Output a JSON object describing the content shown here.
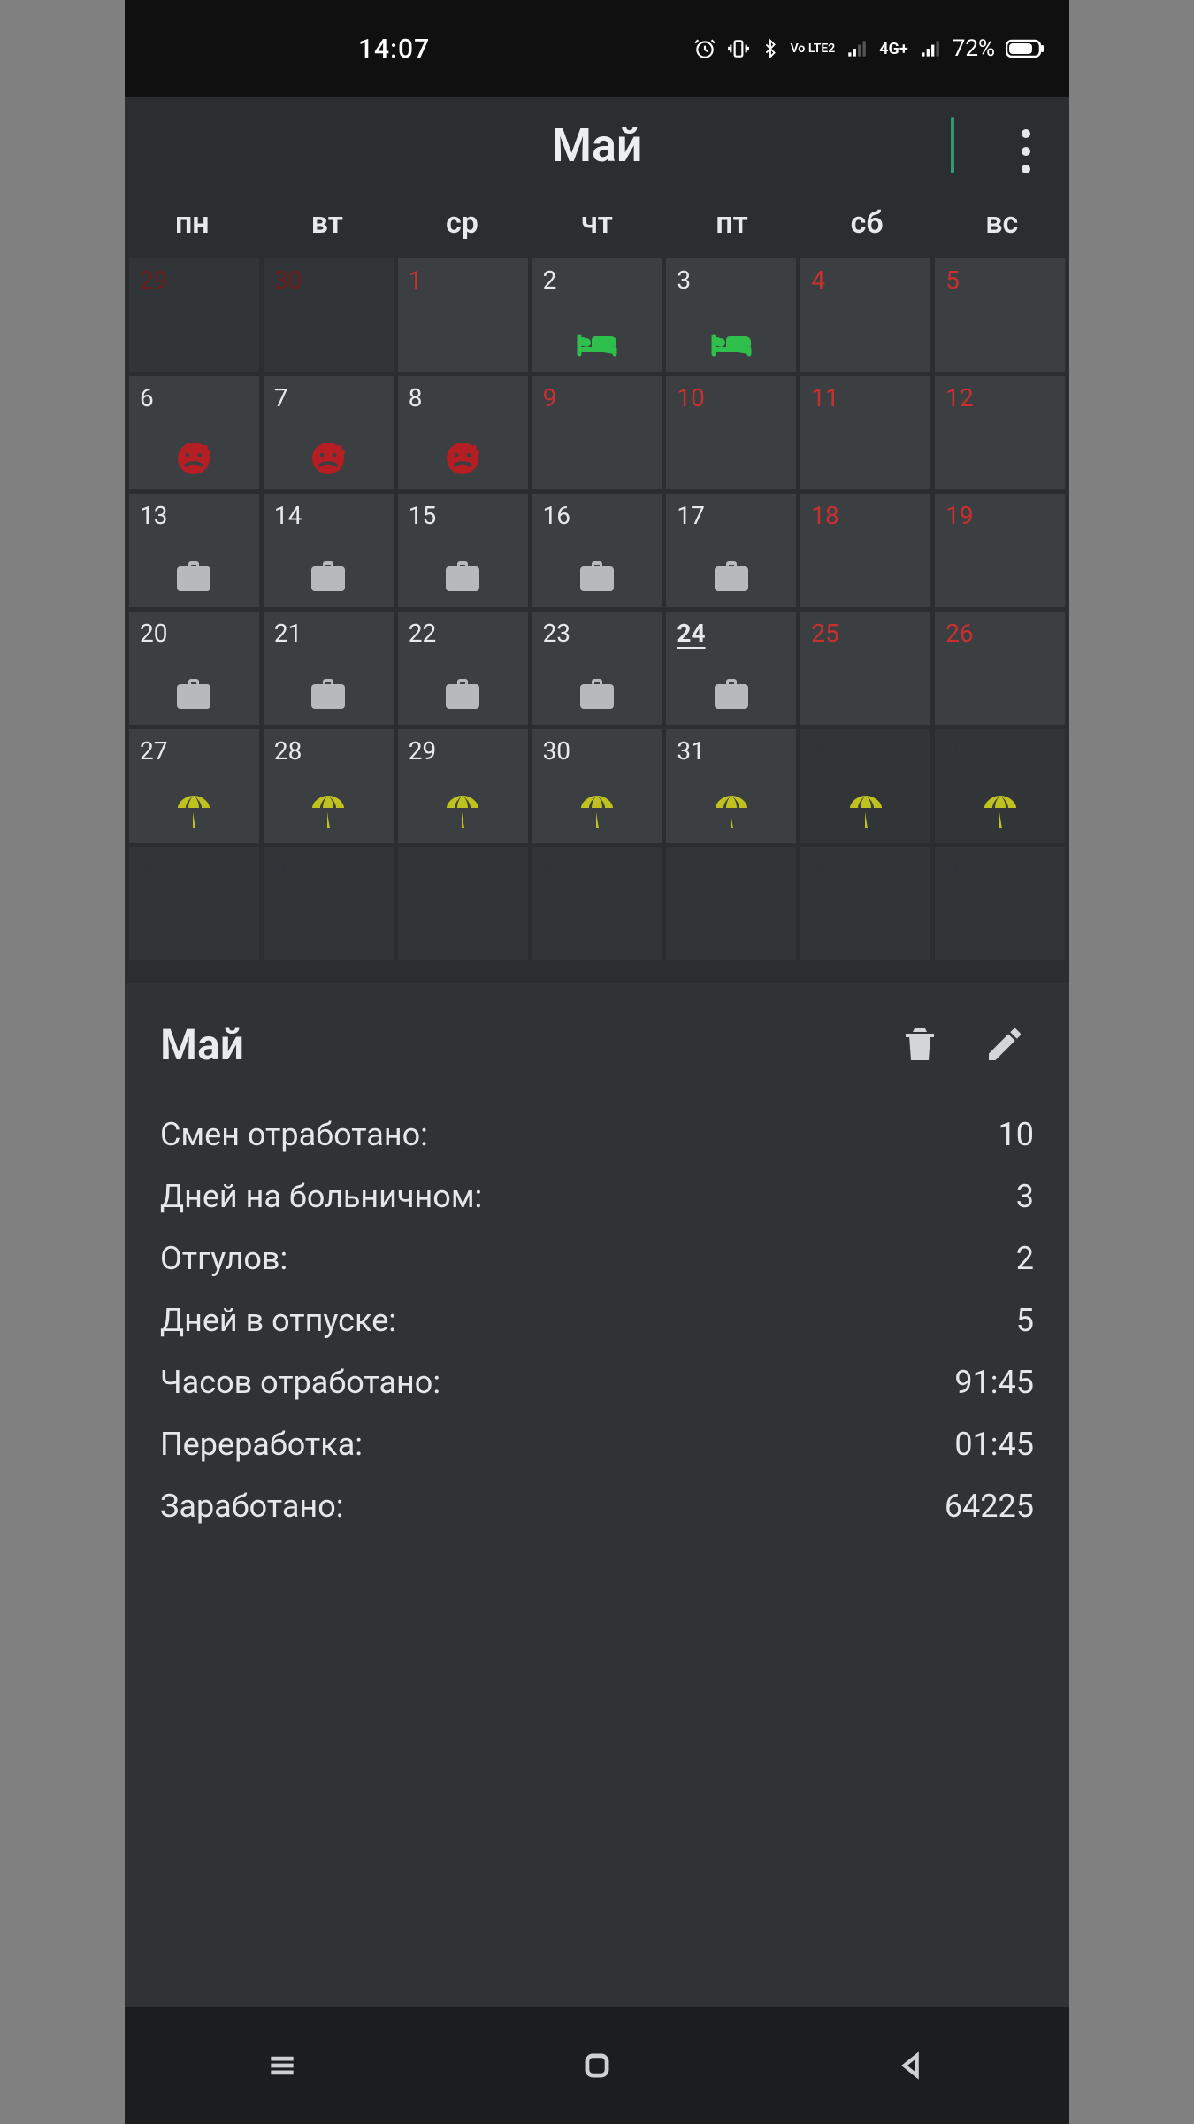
{
  "status": {
    "time": "14:07",
    "battery_pct": "72%",
    "net_label": "4G+",
    "volte_label": "Vo LTE2"
  },
  "header": {
    "title": "Май"
  },
  "weekdays": [
    "пн",
    "вт",
    "ср",
    "чт",
    "пт",
    "сб",
    "вс"
  ],
  "calendar": {
    "rows": [
      [
        {
          "n": "29",
          "kind": "prev",
          "holiday": true
        },
        {
          "n": "30",
          "kind": "prev",
          "holiday": true
        },
        {
          "n": "1",
          "holiday": true
        },
        {
          "n": "2",
          "mark": "bed"
        },
        {
          "n": "3",
          "mark": "bed"
        },
        {
          "n": "4",
          "weekend": true
        },
        {
          "n": "5",
          "weekend": true
        }
      ],
      [
        {
          "n": "6",
          "mark": "sick"
        },
        {
          "n": "7",
          "mark": "sick"
        },
        {
          "n": "8",
          "mark": "sick"
        },
        {
          "n": "9",
          "holiday": true
        },
        {
          "n": "10",
          "holiday": true
        },
        {
          "n": "11",
          "weekend": true
        },
        {
          "n": "12",
          "weekend": true
        }
      ],
      [
        {
          "n": "13",
          "mark": "work"
        },
        {
          "n": "14",
          "mark": "work"
        },
        {
          "n": "15",
          "mark": "work"
        },
        {
          "n": "16",
          "mark": "work"
        },
        {
          "n": "17",
          "mark": "work"
        },
        {
          "n": "18",
          "weekend": true
        },
        {
          "n": "19",
          "weekend": true
        }
      ],
      [
        {
          "n": "20",
          "mark": "work"
        },
        {
          "n": "21",
          "mark": "work"
        },
        {
          "n": "22",
          "mark": "work"
        },
        {
          "n": "23",
          "mark": "work"
        },
        {
          "n": "24",
          "mark": "work",
          "today": true
        },
        {
          "n": "25",
          "weekend": true
        },
        {
          "n": "26",
          "weekend": true
        }
      ],
      [
        {
          "n": "27",
          "mark": "vac"
        },
        {
          "n": "28",
          "mark": "vac"
        },
        {
          "n": "29",
          "mark": "vac"
        },
        {
          "n": "30",
          "mark": "vac"
        },
        {
          "n": "31",
          "mark": "vac"
        },
        {
          "n": "1",
          "kind": "next",
          "weekend": true,
          "mark": "vac"
        },
        {
          "n": "2",
          "kind": "next",
          "weekend": true,
          "mark": "vac"
        }
      ],
      [
        {
          "n": "3",
          "kind": "next"
        },
        {
          "n": "4",
          "kind": "next"
        },
        {
          "n": "5",
          "kind": "next"
        },
        {
          "n": "6",
          "kind": "next"
        },
        {
          "n": "7",
          "kind": "next"
        },
        {
          "n": "8",
          "kind": "next",
          "weekend": true
        },
        {
          "n": "9",
          "kind": "next",
          "weekend": true
        }
      ]
    ]
  },
  "summary": {
    "title": "Май",
    "stats": [
      {
        "label": "Смен отработано:",
        "value": "10"
      },
      {
        "label": "Дней на больничном:",
        "value": "3"
      },
      {
        "label": "Отгулов:",
        "value": "2"
      },
      {
        "label": "Дней в отпуске:",
        "value": "5"
      },
      {
        "label": "Часов отработано:",
        "value": "91:45"
      },
      {
        "label": "Переработка:",
        "value": "01:45"
      },
      {
        "label": "Заработано:",
        "value": "64225"
      }
    ]
  }
}
